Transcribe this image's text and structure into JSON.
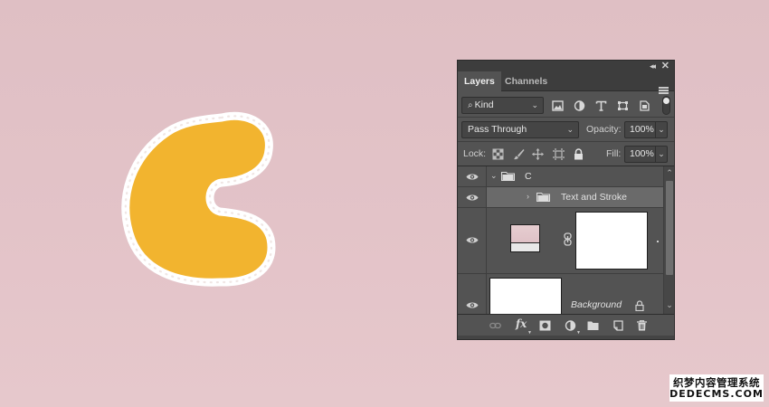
{
  "panel": {
    "collapse_glyph": "◂◂",
    "close_glyph": "✕",
    "tabs": [
      {
        "label": "Layers",
        "active": true
      },
      {
        "label": "Channels",
        "active": false
      }
    ],
    "filter": {
      "kind_label": "Kind",
      "icons": [
        "pixel-layer-filter-icon",
        "adjustment-layer-filter-icon",
        "type-layer-filter-icon",
        "shape-layer-filter-icon",
        "smart-object-filter-icon"
      ]
    },
    "blend_mode": "Pass Through",
    "opacity_label": "Opacity:",
    "opacity_value": "100%",
    "lock_label": "Lock:",
    "lock_icons": [
      "lock-transparent-pixels-icon",
      "lock-image-pixels-icon",
      "lock-position-icon",
      "artboard-autonest-icon",
      "lock-all-icon"
    ],
    "fill_label": "Fill:",
    "fill_value": "100%",
    "layers": [
      {
        "name": "C",
        "type": "group",
        "expanded": true,
        "visible": true
      },
      {
        "name": "Text and Stroke",
        "type": "group",
        "expanded": false,
        "visible": true,
        "selected": true
      },
      {
        "name": "",
        "type": "smart-object-with-mask",
        "visible": true
      },
      {
        "name": "Background",
        "type": "background",
        "locked": true,
        "visible": true
      }
    ],
    "footer_icons": [
      "link-layers-icon",
      "fx-icon",
      "add-mask-icon",
      "adjustment-layer-icon",
      "new-group-icon",
      "new-layer-icon",
      "delete-icon"
    ],
    "fx_label": "fx"
  },
  "canvas": {
    "letter_color": "#F2B42F",
    "stroke_color": "#FFFFFF",
    "background_color": "#E1C2C6"
  },
  "watermark": {
    "line1": "织梦内容管理系统",
    "line2": "DEDECMS.COM"
  }
}
